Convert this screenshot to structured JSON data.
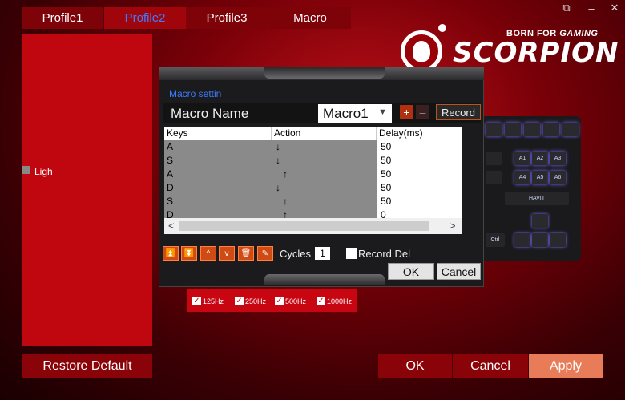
{
  "tabs": [
    {
      "label": "Profile1",
      "active": false
    },
    {
      "label": "Profile2",
      "active": true
    },
    {
      "label": "Profile3",
      "active": false
    },
    {
      "label": "Macro",
      "active": false
    }
  ],
  "window_controls": {
    "restore": "⧉",
    "minimize": "–",
    "close": "✕"
  },
  "brand": {
    "tagline": "BORN FOR",
    "tagline_accent": "GAMING",
    "name": "SCORPION"
  },
  "left_panel": {
    "lighting_label": "Ligh"
  },
  "keyboard": {
    "keys": [
      "A1",
      "A2",
      "A3",
      "A4",
      "A5",
      "A6",
      "Ctrl",
      "HAVIT"
    ]
  },
  "macro_dialog": {
    "section_title": "Macro settin",
    "name_label": "Macro Name",
    "selected_macro": "Macro1",
    "add_label": "+",
    "remove_label": "–",
    "record_label": "Record",
    "columns": [
      "Keys",
      "Action",
      "Delay(ms)"
    ],
    "rows": [
      {
        "key": "A",
        "action": "↓",
        "delay": "50"
      },
      {
        "key": "S",
        "action": "↓",
        "delay": "50"
      },
      {
        "key": "A",
        "action": "↑",
        "delay": "50"
      },
      {
        "key": "D",
        "action": "↓",
        "delay": "50"
      },
      {
        "key": "S",
        "action": "↑",
        "delay": "50"
      },
      {
        "key": "D",
        "action": "↑",
        "delay": "0"
      }
    ],
    "scroll_left": "<",
    "scroll_right": ">",
    "toolbar_icons": [
      "⏫",
      "⏬",
      "^",
      "v",
      "🗑",
      "✎"
    ],
    "cycles_label": "Cycles",
    "cycles_value": "1",
    "record_delay_label": "Record Del",
    "ok_label": "OK",
    "cancel_label": "Cancel"
  },
  "polling_rates": [
    {
      "label": "125Hz",
      "checked": true
    },
    {
      "label": "250Hz",
      "checked": true
    },
    {
      "label": "500Hz",
      "checked": true
    },
    {
      "label": "1000Hz",
      "checked": true
    }
  ],
  "bottom": {
    "restore_label": "Restore Default",
    "ok_label": "OK",
    "cancel_label": "Cancel",
    "apply_label": "Apply"
  },
  "colors": {
    "accent_red": "#c80612",
    "apply_orange": "#e87c58",
    "active_tab_text": "#3f7bff"
  }
}
